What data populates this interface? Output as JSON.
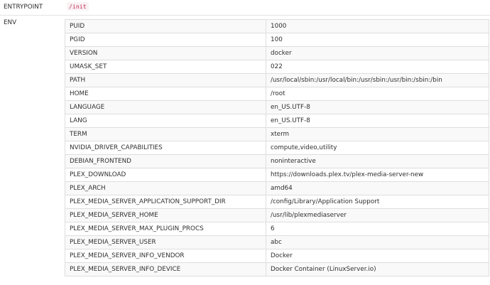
{
  "entrypoint": {
    "key": "ENTRYPOINT",
    "value": "/init"
  },
  "env": {
    "key": "ENV",
    "rows": [
      {
        "name": "PUID",
        "value": "1000"
      },
      {
        "name": "PGID",
        "value": "100"
      },
      {
        "name": "VERSION",
        "value": "docker"
      },
      {
        "name": "UMASK_SET",
        "value": "022"
      },
      {
        "name": "PATH",
        "value": "/usr/local/sbin:/usr/local/bin:/usr/sbin:/usr/bin:/sbin:/bin"
      },
      {
        "name": "HOME",
        "value": "/root"
      },
      {
        "name": "LANGUAGE",
        "value": "en_US.UTF-8"
      },
      {
        "name": "LANG",
        "value": "en_US.UTF-8"
      },
      {
        "name": "TERM",
        "value": "xterm"
      },
      {
        "name": "NVIDIA_DRIVER_CAPABILITIES",
        "value": "compute,video,utility"
      },
      {
        "name": "DEBIAN_FRONTEND",
        "value": "noninteractive"
      },
      {
        "name": "PLEX_DOWNLOAD",
        "value": "https://downloads.plex.tv/plex-media-server-new"
      },
      {
        "name": "PLEX_ARCH",
        "value": "amd64"
      },
      {
        "name": "PLEX_MEDIA_SERVER_APPLICATION_SUPPORT_DIR",
        "value": "/config/Library/Application Support"
      },
      {
        "name": "PLEX_MEDIA_SERVER_HOME",
        "value": "/usr/lib/plexmediaserver"
      },
      {
        "name": "PLEX_MEDIA_SERVER_MAX_PLUGIN_PROCS",
        "value": "6"
      },
      {
        "name": "PLEX_MEDIA_SERVER_USER",
        "value": "abc"
      },
      {
        "name": "PLEX_MEDIA_SERVER_INFO_VENDOR",
        "value": "Docker"
      },
      {
        "name": "PLEX_MEDIA_SERVER_INFO_DEVICE",
        "value": "Docker Container (LinuxServer.io)"
      }
    ]
  }
}
